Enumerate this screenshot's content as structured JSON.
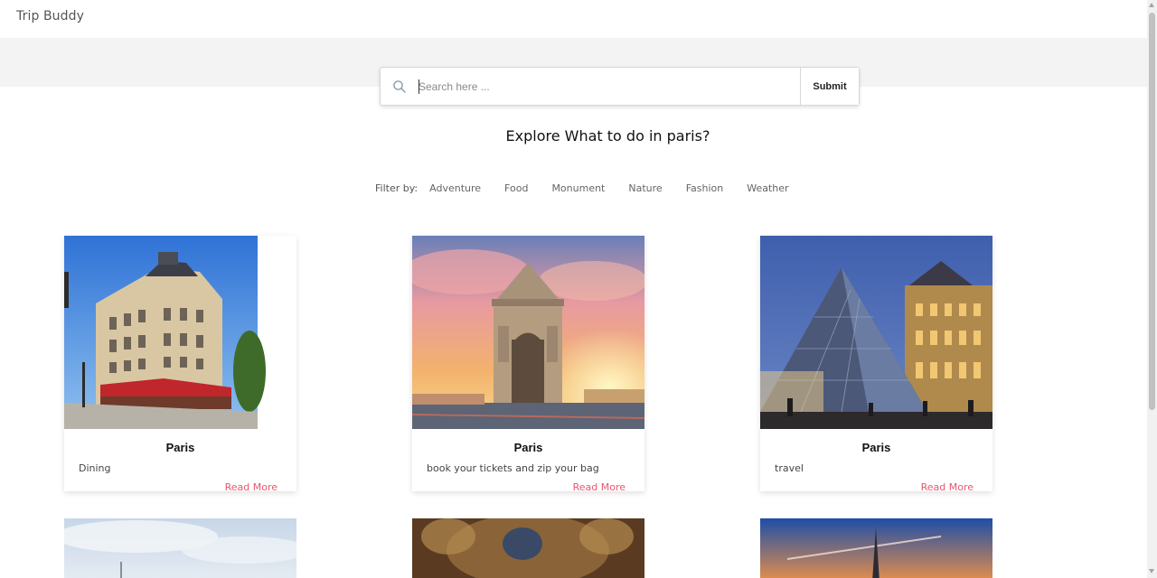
{
  "app": {
    "brand": "Trip Buddy"
  },
  "search": {
    "placeholder": "Search here ...",
    "value": "",
    "submit_label": "Submit"
  },
  "heading": "Explore What to do in paris?",
  "filters": {
    "label": "Filter by:",
    "items": [
      "Adventure",
      "Food",
      "Monument",
      "Nature",
      "Fashion",
      "Weather"
    ]
  },
  "cards": [
    {
      "title": "Paris",
      "description": "Dining",
      "link": "Read More",
      "image": "parisian-corner-building-cafe"
    },
    {
      "title": "Paris",
      "description": "book your tickets and zip your bag",
      "link": "Read More",
      "image": "arc-de-triomphe-sunset"
    },
    {
      "title": "Paris",
      "description": "travel",
      "link": "Read More",
      "image": "louvre-pyramid-dusk"
    }
  ],
  "cards_row2": [
    {
      "image": "paris-skyline-clouds"
    },
    {
      "image": "ornate-palace-ceiling"
    },
    {
      "image": "eiffel-tower-sunset"
    }
  ],
  "colors": {
    "accent": "#e8566f",
    "band": "#f3f3f3"
  }
}
